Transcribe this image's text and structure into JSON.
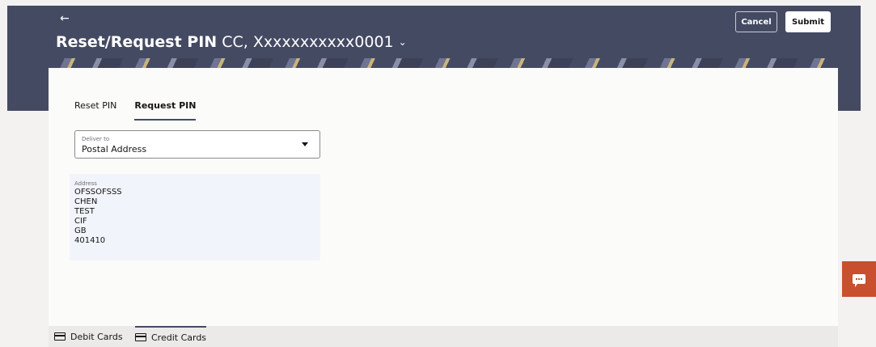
{
  "header": {
    "back_glyph": "←",
    "title_bold": "Reset/Request PIN",
    "title_account": "CC, Xxxxxxxxxxx0001",
    "chevron": "⌄",
    "cancel_label": "Cancel",
    "submit_label": "Submit"
  },
  "tabs": [
    {
      "label": "Reset PIN",
      "active": false
    },
    {
      "label": "Request PIN",
      "active": true
    }
  ],
  "deliver_to": {
    "label": "Deliver to",
    "value": "Postal Address"
  },
  "address": {
    "label": "Address",
    "lines": [
      "OFSSOFSSS",
      "CHEN",
      "TEST",
      "CIF",
      "GB",
      "401410"
    ]
  },
  "bottom_tabs": [
    {
      "label": "Debit Cards",
      "active": false
    },
    {
      "label": "Credit Cards",
      "active": true
    }
  ],
  "colors": {
    "header_bg": "#454a63",
    "chat_bg": "#c9502e",
    "address_bg": "#f1f4fb"
  },
  "icons": {
    "back": "back-arrow-icon",
    "chevron": "chevron-down-icon",
    "dropdown": "caret-down-icon",
    "chat": "chat-icon",
    "card": "card-icon"
  }
}
